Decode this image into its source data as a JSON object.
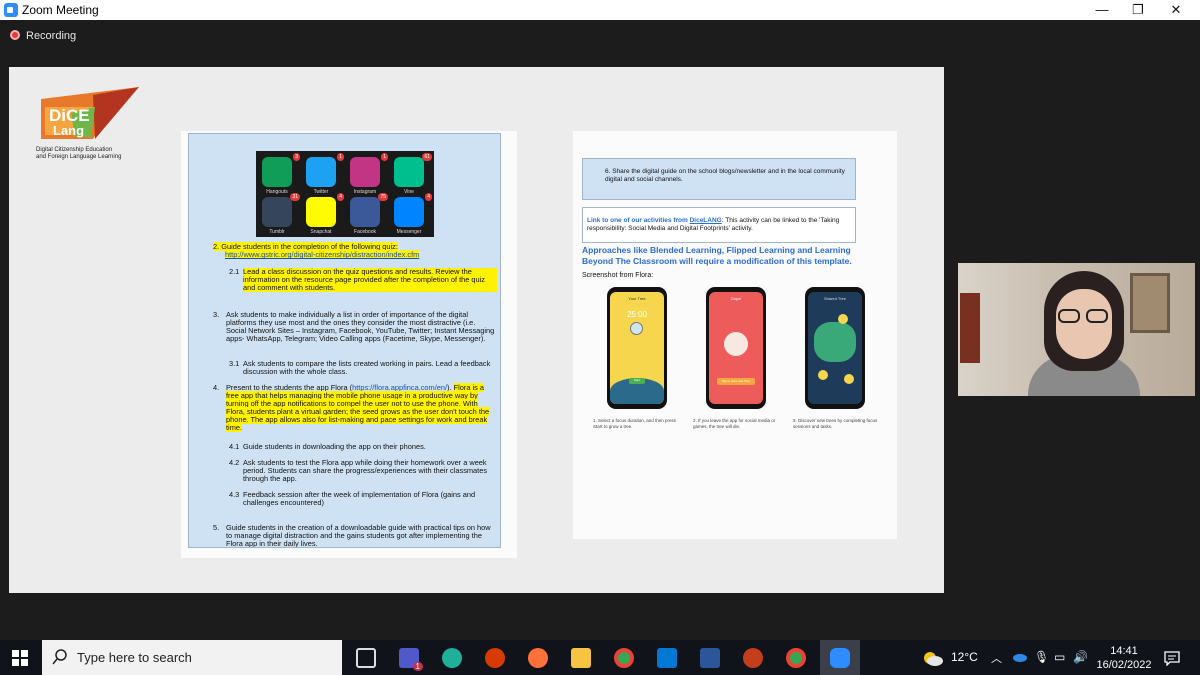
{
  "window": {
    "title": "Zoom Meeting",
    "minimize": "—",
    "restore": "❐",
    "close": "✕"
  },
  "recording": {
    "label": "Recording"
  },
  "logo": {
    "text": "DiCE Lang",
    "caption_line1": "Digital Citizenship Education",
    "caption_line2": "and Foreign Language Learning"
  },
  "apps": [
    {
      "name": "Hangouts",
      "badge": "3",
      "color": "#0f9d58"
    },
    {
      "name": "Twitter",
      "badge": "1",
      "color": "#1da1f2"
    },
    {
      "name": "Instagram",
      "badge": "1",
      "color": "#c13584"
    },
    {
      "name": "Vine",
      "badge": "61",
      "color": "#00bf8f"
    },
    {
      "name": "Tumblr",
      "badge": "31",
      "color": "#35465c"
    },
    {
      "name": "Snapchat",
      "badge": "4",
      "color": "#fffc00"
    },
    {
      "name": "Facebook",
      "badge": "75",
      "color": "#3b5998"
    },
    {
      "name": "Messenger",
      "badge": "4",
      "color": "#0084ff"
    }
  ],
  "left_doc": {
    "item2_title": "2.  Guide students in the completion of the following quiz:",
    "item2_link": "http://www.gstric.org/digital-citizenship/distraction/index.cfm",
    "item21_num": "2.1",
    "item21": "Lead a class discussion on the quiz questions and results. Review the information on the resource page provided after the completion of the quiz and comment with students.",
    "item3_num": "3.",
    "item3": "Ask students to make individually a list in order of importance of the digital platforms they use most and the ones they consider the most distractive (i.e. Social Network Sites – Instagram, Facebook, YouTube, Twitter; Instant Messaging apps- WhatsApp, Telegram; Video Calling apps (Facetime, Skype, Messenger).",
    "item31_num": "3.1",
    "item31": "Ask students to compare the lists created working in pairs. Lead a feedback discussion with the whole class.",
    "item4_num": "4.",
    "item4_a": "Present to the students the app Flora (",
    "item4_link": "https://flora.appfinca.com/en/",
    "item4_b": ").",
    "item4_hl": "Flora is a free app that helps managing the mobile phone usage in a productive way by turning off the app notifications to compel the user not to use the phone. With Flora, students plant a virtual garden; the seed grows as the user don't touch the phone. The app allows also for list-making and pace settings for work and break time.",
    "item41_num": "4.1",
    "item41": "Guide students in downloading the app on their phones.",
    "item42_num": "4.2",
    "item42": "Ask students to test the Flora app while doing their homework over a week period. Students can share the progress/experiences with their classmates through the app.",
    "item43_num": "4.3",
    "item43": "Feedback session after the week of implementation of Flora (gains and challenges encountered)",
    "item5_num": "5.",
    "item5": "Guide students in the creation of a downloadable guide with practical tips on how to manage digital distraction and the gains students got after implementing the Flora app in their daily lives."
  },
  "right_doc": {
    "item6": "6.   Share the digital guide on the school blogs/newsletter and in the local community digital and social channels.",
    "link_label": "Link to one of our activities from",
    "link_name": "DiceLANG",
    "link_rest": ": This activity can be linked to the 'Taking responsibility: Social Media and Digital Footprints' activity.",
    "approaches": "Approaches like Blended Learning, Flipped Learning and Learning Beyond The Classroom will require a modification of this template.",
    "screenshot_label": "Screenshot from Flora:",
    "phone1_top": "Your Tree",
    "phone1_time": "25:00",
    "phone1_btn": "Start",
    "phone2_top": "Oops!",
    "phone2_btn": "Tap to start new Tree",
    "phone3_top": "Shared Tree",
    "cap1": "1. Select a focus duration, and then press Start to grow a tree.",
    "cap2": "2. If you leave the app for social media or games, the tree will die.",
    "cap3": "3. Discover new trees by completing focus sessions and tasks."
  },
  "taskbar": {
    "search_placeholder": "Type here to search",
    "temperature": "12°C",
    "time": "14:41",
    "date": "16/02/2022",
    "teams_badge": "1"
  }
}
